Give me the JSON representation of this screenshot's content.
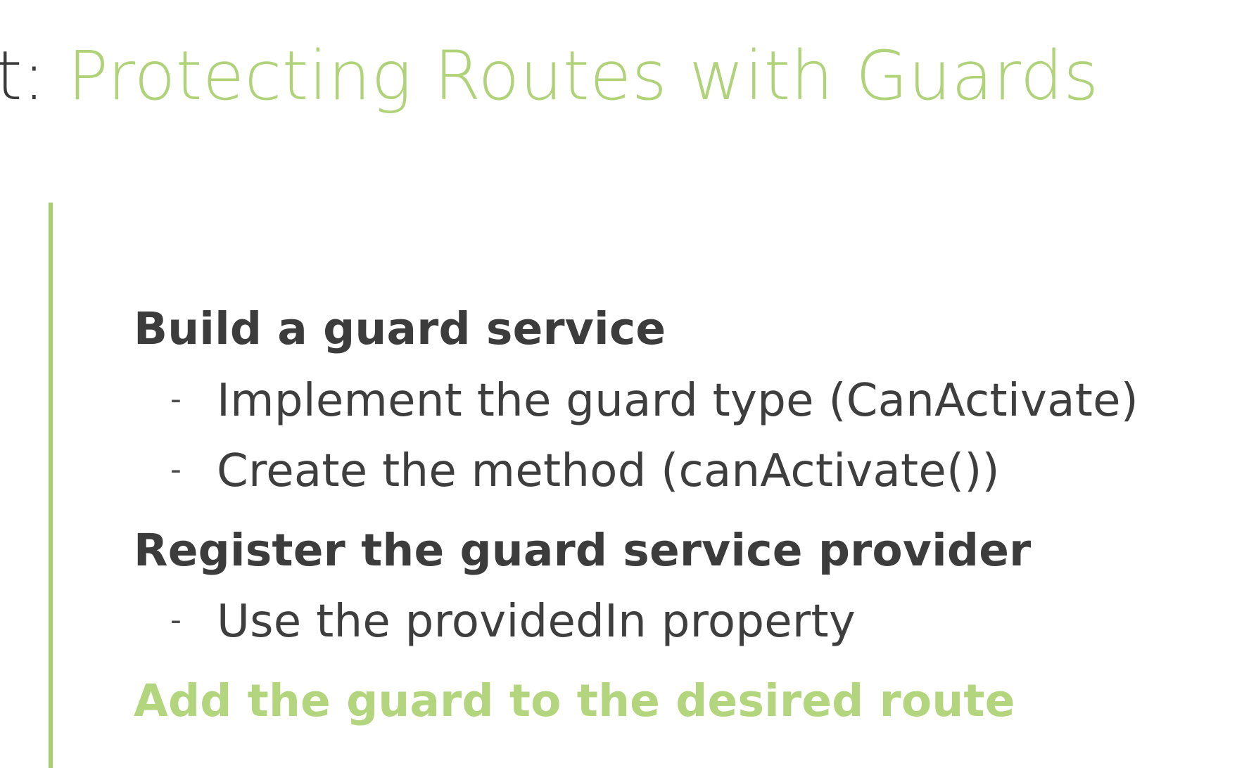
{
  "slide": {
    "title_prefix": "t: ",
    "title_main": "Protecting Routes with Guards",
    "accent_color": "#a9cf6f",
    "sections": [
      {
        "heading": "Build a guard service",
        "items": [
          "Implement the guard type (CanActivate)",
          "Create the method (canActivate())"
        ]
      },
      {
        "heading": "Register the guard service provider",
        "items": [
          "Use the providedIn property"
        ]
      },
      {
        "heading": "Add the guard to the desired route",
        "items": []
      }
    ],
    "bullet_glyph": "-"
  }
}
